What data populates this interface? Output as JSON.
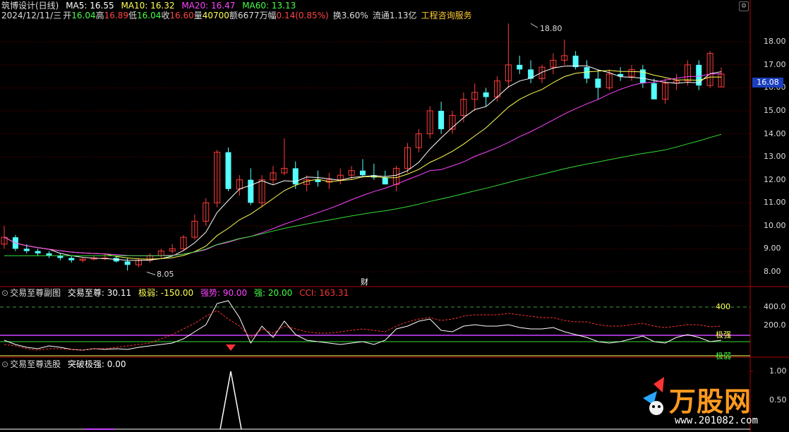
{
  "header": {
    "title": "筑博设计(日线)",
    "ma": [
      {
        "label": "MA5: 16.55",
        "color": "#ffffff"
      },
      {
        "label": "MA10: 16.32",
        "color": "#ffff55"
      },
      {
        "label": "MA20: 16.47",
        "color": "#ff44ff"
      },
      {
        "label": "MA60: 13.13",
        "color": "#44ff44"
      }
    ]
  },
  "quote": {
    "date": "2024/12/11/三",
    "open_label": "开",
    "open": "16.04",
    "high_label": "高",
    "high": "16.89",
    "low_label": "低",
    "low": "16.04",
    "close_label": "收",
    "close": "16.60",
    "vol_label": "量",
    "vol": "40700",
    "amount_label": "额",
    "amount": "6677万",
    "change_label": "幅",
    "change": "0.14(0.85%)",
    "turnover": "换3.60%",
    "float": "流通1.13亿",
    "service": "工程咨询服务"
  },
  "price_axis": [
    "18.00",
    "17.00",
    "16.00",
    "15.00",
    "14.00",
    "13.00",
    "12.00",
    "11.00",
    "10.00",
    "9.00",
    "8.00"
  ],
  "current_price": "16.08",
  "annotations": {
    "high_mark": "18.80",
    "low_mark": "8.05",
    "cai": "财"
  },
  "panel2": {
    "title": "交易至尊副图",
    "items": [
      {
        "label": "交易至尊: 30.11",
        "color": "#ffffff"
      },
      {
        "label": "极弱: -150.00",
        "color": "#ffff55"
      },
      {
        "label": "强势: 90.00",
        "color": "#ff44ff"
      },
      {
        "label": "强: 20.00",
        "color": "#44ff44"
      },
      {
        "label": "CCI: 163.31",
        "color": "#ff3333"
      }
    ],
    "axis": [
      "400.0",
      "200.0"
    ],
    "line_label_400": "400",
    "label_strong": "极强",
    "label_weak": "极弱"
  },
  "panel3": {
    "title": "交易至尊选股",
    "items": [
      {
        "label": "突破极强: 0.00",
        "color": "#ffffff"
      }
    ],
    "axis": [
      "1.00",
      "0.50"
    ]
  },
  "brand": {
    "name": "万股网",
    "url": "www.201082.com"
  },
  "chart_data": {
    "type": "candlestick",
    "candles": [
      [
        9.2,
        10.0,
        9.0,
        9.5
      ],
      [
        9.5,
        9.6,
        8.9,
        9.0
      ],
      [
        9.0,
        9.2,
        8.8,
        8.9
      ],
      [
        8.9,
        9.0,
        8.7,
        8.8
      ],
      [
        8.8,
        8.9,
        8.6,
        8.7
      ],
      [
        8.7,
        8.8,
        8.5,
        8.6
      ],
      [
        8.6,
        8.7,
        8.4,
        8.5
      ],
      [
        8.5,
        8.6,
        8.4,
        8.55
      ],
      [
        8.55,
        8.7,
        8.5,
        8.6
      ],
      [
        8.6,
        8.8,
        8.5,
        8.6
      ],
      [
        8.6,
        8.7,
        8.4,
        8.45
      ],
      [
        8.45,
        8.6,
        8.05,
        8.3
      ],
      [
        8.3,
        8.6,
        8.2,
        8.5
      ],
      [
        8.5,
        8.8,
        8.4,
        8.7
      ],
      [
        8.7,
        9.0,
        8.6,
        8.9
      ],
      [
        8.9,
        9.2,
        8.8,
        9.0
      ],
      [
        9.0,
        9.6,
        8.9,
        9.5
      ],
      [
        9.5,
        10.5,
        9.4,
        10.2
      ],
      [
        10.2,
        11.2,
        10.0,
        11.0
      ],
      [
        11.0,
        13.3,
        10.8,
        13.2
      ],
      [
        13.2,
        13.4,
        11.5,
        11.6
      ],
      [
        11.6,
        12.2,
        11.3,
        12.0
      ],
      [
        12.0,
        12.5,
        10.9,
        11.0
      ],
      [
        11.0,
        12.2,
        10.8,
        12.0
      ],
      [
        12.0,
        12.6,
        11.8,
        12.3
      ],
      [
        12.3,
        13.8,
        12.2,
        12.5
      ],
      [
        12.5,
        12.8,
        11.6,
        11.8
      ],
      [
        11.8,
        12.2,
        11.5,
        12.0
      ],
      [
        12.0,
        12.4,
        11.7,
        11.9
      ],
      [
        11.9,
        12.3,
        11.6,
        12.0
      ],
      [
        12.0,
        12.5,
        11.8,
        12.2
      ],
      [
        12.2,
        12.6,
        12.0,
        12.4
      ],
      [
        12.4,
        12.9,
        12.1,
        12.2
      ],
      [
        12.2,
        12.7,
        12.0,
        12.1
      ],
      [
        12.1,
        12.4,
        11.8,
        11.8
      ],
      [
        11.8,
        12.6,
        11.5,
        12.5
      ],
      [
        12.5,
        13.6,
        12.3,
        13.4
      ],
      [
        13.4,
        14.2,
        13.2,
        14.0
      ],
      [
        14.0,
        15.2,
        13.8,
        15.0
      ],
      [
        15.0,
        15.4,
        14.0,
        14.2
      ],
      [
        14.2,
        15.0,
        14.0,
        14.8
      ],
      [
        14.8,
        15.8,
        14.5,
        15.5
      ],
      [
        15.5,
        16.2,
        15.0,
        15.8
      ],
      [
        15.8,
        16.0,
        15.2,
        15.6
      ],
      [
        15.6,
        16.5,
        15.4,
        16.3
      ],
      [
        16.3,
        18.8,
        16.0,
        17.0
      ],
      [
        17.0,
        17.4,
        16.6,
        16.8
      ],
      [
        16.8,
        17.2,
        16.2,
        16.4
      ],
      [
        16.4,
        17.0,
        16.2,
        16.9
      ],
      [
        16.9,
        17.5,
        16.6,
        17.2
      ],
      [
        17.2,
        18.1,
        17.0,
        17.4
      ],
      [
        17.4,
        17.6,
        16.8,
        16.9
      ],
      [
        16.9,
        17.2,
        16.2,
        16.4
      ],
      [
        16.4,
        16.8,
        15.5,
        16.0
      ],
      [
        16.0,
        16.8,
        15.9,
        16.6
      ],
      [
        16.6,
        16.9,
        16.3,
        16.5
      ],
      [
        16.5,
        17.0,
        16.3,
        16.8
      ],
      [
        16.8,
        17.0,
        16.0,
        16.2
      ],
      [
        16.2,
        16.4,
        15.6,
        15.5
      ],
      [
        15.5,
        16.4,
        15.3,
        16.2
      ],
      [
        16.2,
        16.6,
        15.9,
        16.3
      ],
      [
        16.3,
        17.2,
        16.1,
        17.0
      ],
      [
        17.0,
        17.2,
        15.9,
        16.1
      ],
      [
        16.1,
        17.6,
        16.0,
        17.5
      ],
      [
        16.04,
        16.89,
        16.04,
        16.6
      ]
    ],
    "ylim": [
      7.6,
      18.9
    ]
  }
}
